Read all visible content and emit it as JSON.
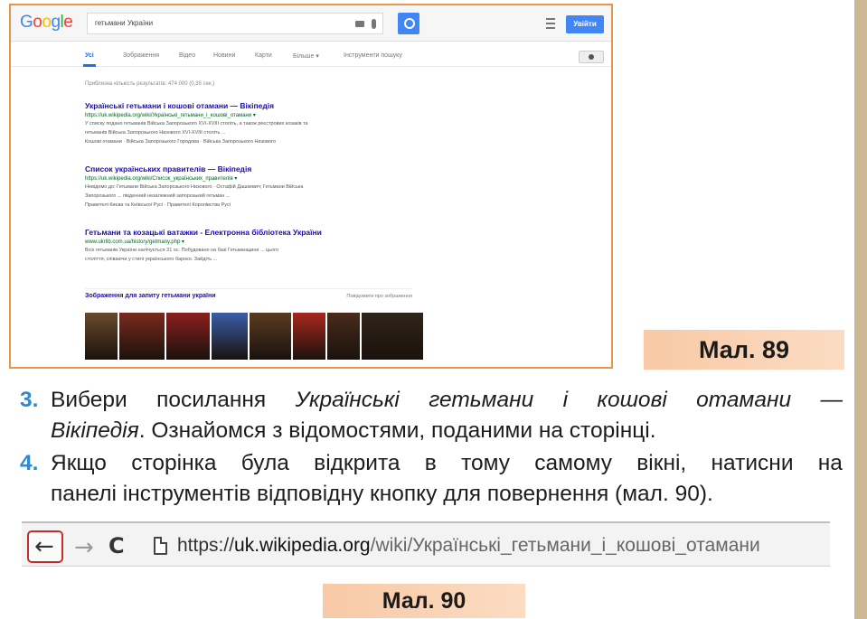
{
  "figure89": {
    "logo": "Google",
    "logo_colors": [
      "#4285f4",
      "#ea4335",
      "#fbbc05",
      "#4285f4",
      "#34a853",
      "#ea4335"
    ],
    "query": "гетьмани України",
    "signin": "Увійти",
    "tabs": [
      "Усі",
      "Зображення",
      "Відео",
      "Новини",
      "Карти",
      "Більше ▾",
      "Інструменти пошуку"
    ],
    "stats": "Приблизна кількість результатів: 474 000 (0,35 сек.)",
    "results": [
      {
        "title": "Українські гетьмани і кошові отамани — Вікіпедія",
        "url": "https://uk.wikipedia.org/wiki/Українські_гетьмани_і_кошові_отамани ▾",
        "snippet": [
          "У списку подано гетьманів Війська Запорозького XVI-XVIII століть, а також реєстрових козаків та",
          "гетьманів Війська Запорозького Низового XVI-XVIII століть ...",
          "Кошові отамани · Війська Запорозького Городова · Війська Запорозького Низового"
        ]
      },
      {
        "title": "Список українських правителів — Вікіпедія",
        "url": "https://uk.wikipedia.org/wiki/Список_українських_правителів ▾",
        "snippet": [
          "Невідомо до: Гетьмани Війська Запорозького Низового · Остафій Дашкевич; Гетьмани Війська",
          "Запорозького ... південний незалежний запорозький гетьман ...",
          "Правителі Києва та Київської Русі · Правителі Королівства Русі"
        ]
      },
      {
        "title": "Гетьмани та козацькі ватажки - Електронна бібліотека України",
        "url": "www.ukrlib.com.ua/history/getmany.php ▾",
        "snippet": [
          "Всіх гетьманів України налічується 31 ос. Побудовано на базі Гетьманщини ... цього",
          "століття, співаючи у стилі українського бароко. Зайдіть ..."
        ]
      }
    ],
    "images_title": "Зображення для запиту гетьмани україни",
    "images_report": "Повідомити про зображення",
    "thumb_colors": [
      "#6b4a2d",
      "#7a2a1e",
      "#8a1f1f",
      "#3a5ea8",
      "#5a3b22",
      "#a8281e",
      "#4a2a1c",
      "#2f2418"
    ],
    "caption": "Мал. 89"
  },
  "items": [
    {
      "number": "3.",
      "line1_words": [
        "Вибери",
        "посилання"
      ],
      "line1_italic_words": [
        "Українські",
        "гетьмани",
        "і",
        "кошові",
        "отамани",
        "—"
      ],
      "line2_italic": "Вікіпедія",
      "line2_rest": ". Ознайомся з відомостями, поданими на сторінці."
    },
    {
      "number": "4.",
      "line1_words": [
        "Якщо",
        "сторінка",
        "була",
        "відкрита",
        "в",
        "тому",
        "самому",
        "вікні,",
        "натисни",
        "на"
      ],
      "line2": "панелі інструментів відповідну кнопку для повернення (мал. 90)."
    }
  ],
  "figure90": {
    "back_icon": "←",
    "forward_icon": "→",
    "reload_icon": "C",
    "url_scheme": "https://",
    "url_host": "uk.wikipedia.org",
    "url_path": "/wiki/Українські_гетьмани_і_кошові_отамани",
    "caption": "Мал. 90",
    "highlight_color": "#c42d2d"
  },
  "accent_number_color": "#2a8ad4",
  "caption_color": "#f8c9a5"
}
